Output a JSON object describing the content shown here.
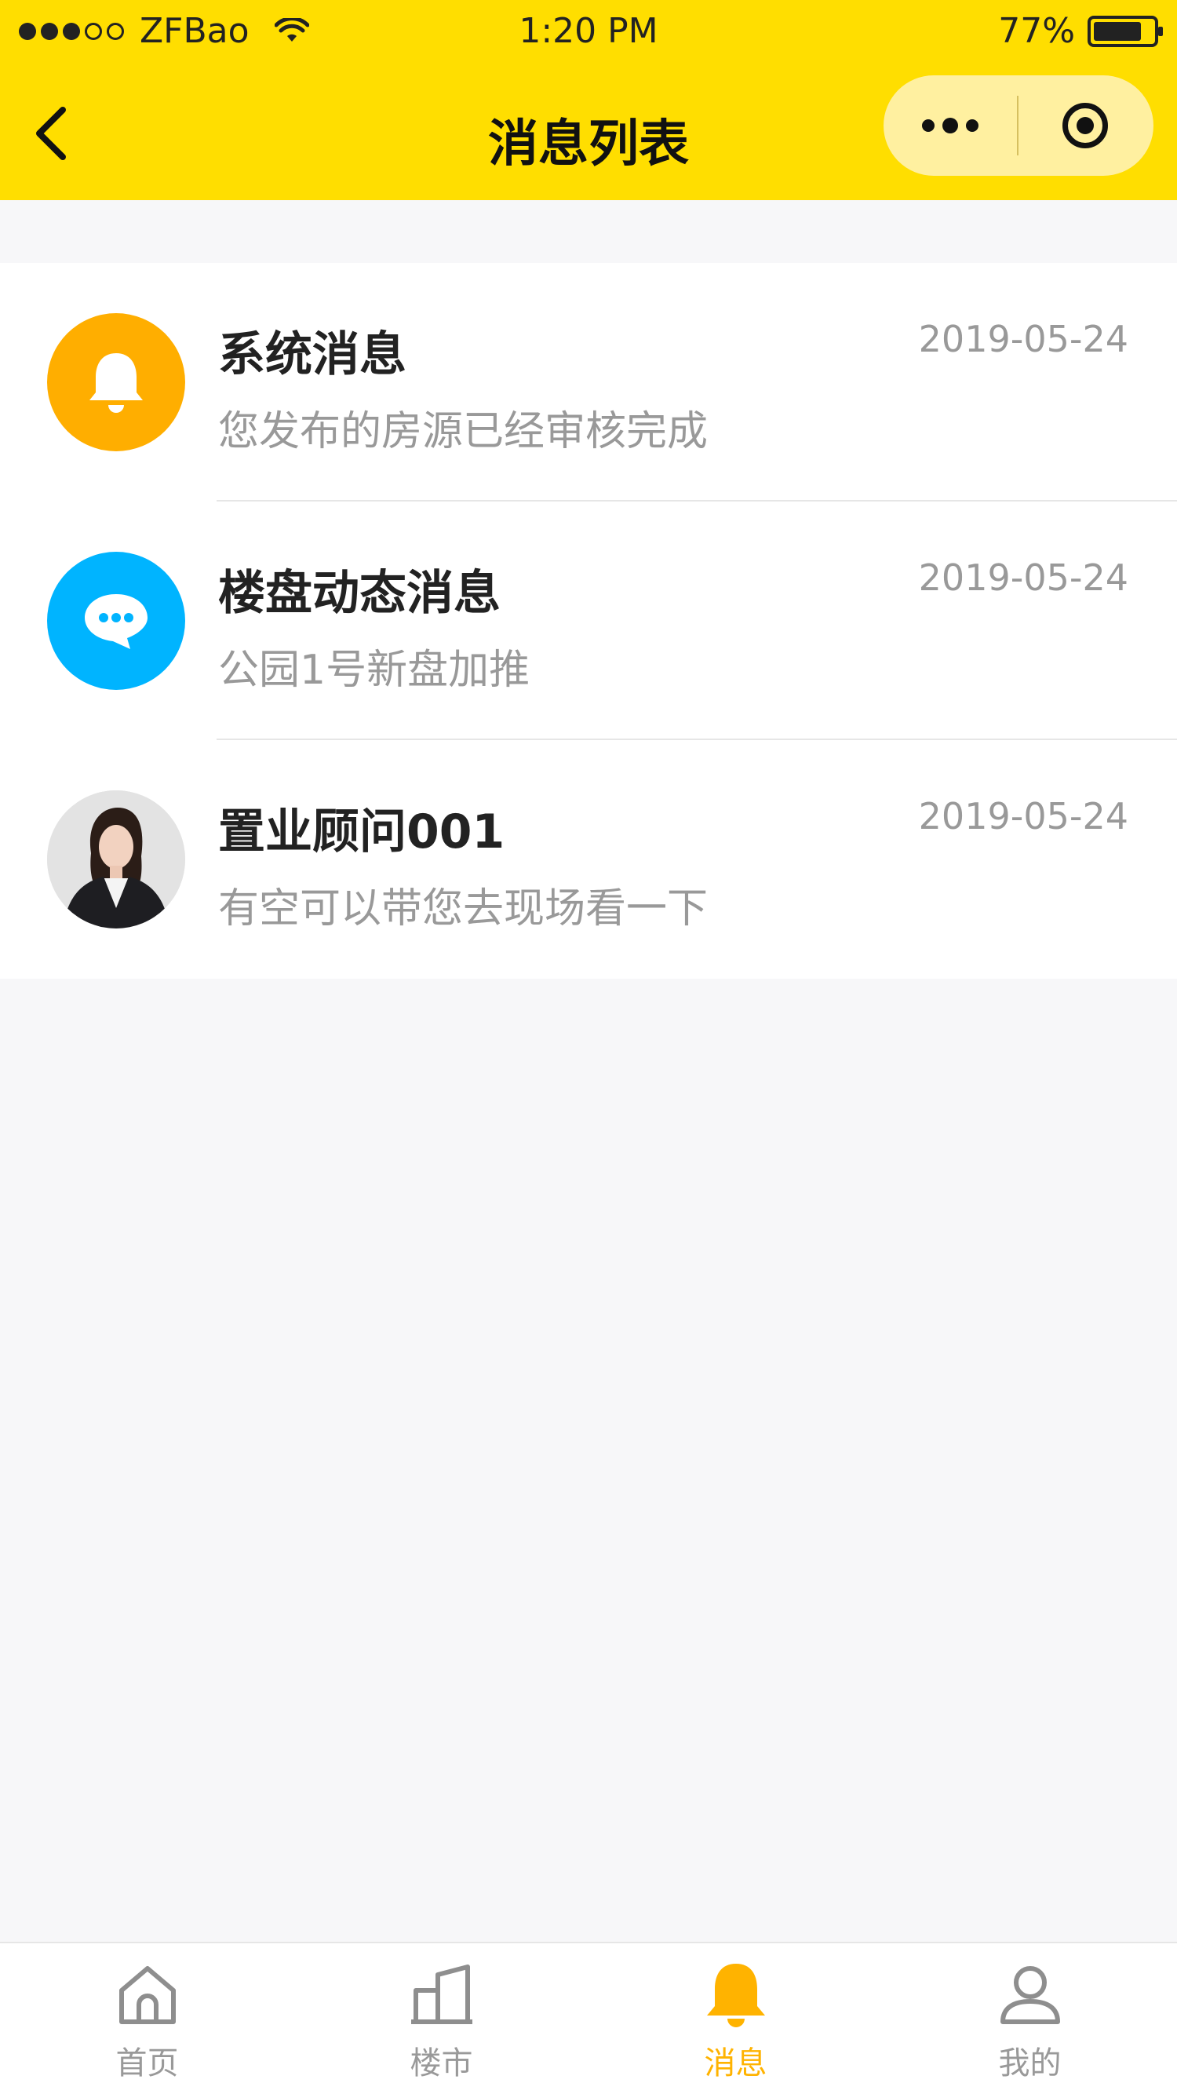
{
  "status_bar": {
    "carrier": "ZFBao",
    "time": "1:20 PM",
    "battery": "77%",
    "signal_bars_filled": 3,
    "signal_bars_total": 5
  },
  "nav": {
    "title": "消息列表",
    "back_icon": "chevron-left-icon",
    "more_icon": "more-dots-icon",
    "close_icon": "target-circle-icon"
  },
  "messages": [
    {
      "title": "系统消息",
      "date": "2019-05-24",
      "preview": "您发布的房源已经审核完成",
      "avatar_icon": "bell-icon",
      "avatar_color": "#FFAE00"
    },
    {
      "title": "楼盘动态消息",
      "date": "2019-05-24",
      "preview": "公园1号新盘加推",
      "avatar_icon": "chat-bubble-icon",
      "avatar_color": "#00B4FF"
    },
    {
      "title": "置业顾问001",
      "date": "2019-05-24",
      "preview": "有空可以带您去现场看一下",
      "avatar_icon": "person-photo",
      "avatar_color": "#d9d9d9"
    }
  ],
  "tabbar": {
    "tabs": [
      {
        "label": "首页",
        "icon": "home-icon",
        "active": false
      },
      {
        "label": "楼市",
        "icon": "building-icon",
        "active": false
      },
      {
        "label": "消息",
        "icon": "bell-icon",
        "active": true
      },
      {
        "label": "我的",
        "icon": "user-icon",
        "active": false
      }
    ],
    "active_color": "#FFB300",
    "inactive_color": "#999999"
  },
  "colors": {
    "header_yellow": "#FFDE00",
    "capsule_bg": "#FFF0A0",
    "page_bg": "#F7F7F9"
  }
}
